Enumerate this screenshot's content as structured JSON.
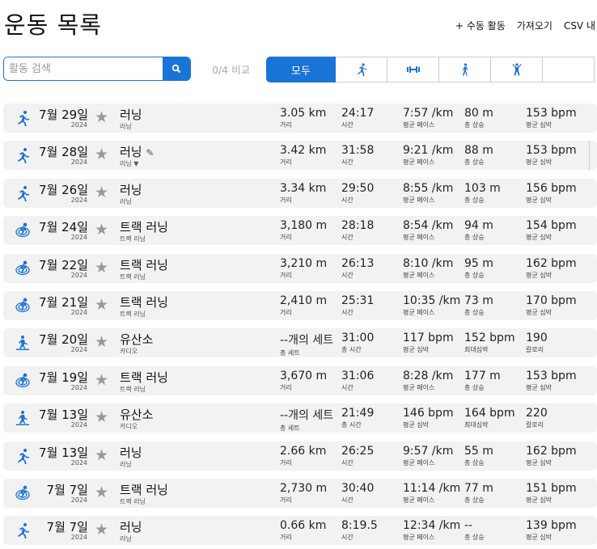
{
  "header": {
    "title": "운동 목록",
    "add_manual": "+ 수동 활동",
    "import": "가져오기",
    "csv": "CSV 내"
  },
  "search": {
    "placeholder": "활동 검색",
    "compare": "0/4 비교"
  },
  "tabs": [
    {
      "label": "모두"
    },
    {
      "icon": "running-icon"
    },
    {
      "icon": "strength-icon"
    },
    {
      "icon": "walking-icon"
    },
    {
      "icon": "cardio-icon"
    },
    {
      "icon": "more"
    }
  ],
  "activities": [
    {
      "type": "run",
      "date": "7월 29일",
      "year": "2024",
      "name": "러닝",
      "sub": "러닝",
      "stats": [
        [
          "3.05 km",
          "거리"
        ],
        [
          "24:17",
          "시간"
        ],
        [
          "7:57 /km",
          "평균 페이스"
        ],
        [
          "80 m",
          "총 상승"
        ],
        [
          "153 bpm",
          "평균 심박"
        ]
      ]
    },
    {
      "type": "run",
      "date": "7월 28일",
      "year": "2024",
      "name": "러닝",
      "sub": "러닝 ▼",
      "edit": true,
      "stats": [
        [
          "3.42 km",
          "거리"
        ],
        [
          "31:58",
          "시간"
        ],
        [
          "9:21 /km",
          "평균 페이스"
        ],
        [
          "88 m",
          "총 상승"
        ],
        [
          "153 bpm",
          "평균 심박"
        ]
      ]
    },
    {
      "type": "run",
      "date": "7월 26일",
      "year": "2024",
      "name": "러닝",
      "sub": "러닝",
      "stats": [
        [
          "3.34 km",
          "거리"
        ],
        [
          "29:50",
          "시간"
        ],
        [
          "8:55 /km",
          "평균 페이스"
        ],
        [
          "103 m",
          "총 상승"
        ],
        [
          "156 bpm",
          "평균 심박"
        ]
      ]
    },
    {
      "type": "track",
      "date": "7월 24일",
      "year": "2024",
      "name": "트랙 러닝",
      "sub": "트랙 러닝",
      "stats": [
        [
          "3,180 m",
          "거리"
        ],
        [
          "28:18",
          "시간"
        ],
        [
          "8:54 /km",
          "평균 페이스"
        ],
        [
          "94 m",
          "총 상승"
        ],
        [
          "154 bpm",
          "평균 심박"
        ]
      ]
    },
    {
      "type": "track",
      "date": "7월 22일",
      "year": "2024",
      "name": "트랙 러닝",
      "sub": "트랙 러닝",
      "stats": [
        [
          "3,210 m",
          "거리"
        ],
        [
          "26:13",
          "시간"
        ],
        [
          "8:10 /km",
          "평균 페이스"
        ],
        [
          "95 m",
          "총 상승"
        ],
        [
          "162 bpm",
          "평균 심박"
        ]
      ]
    },
    {
      "type": "track",
      "date": "7월 21일",
      "year": "2024",
      "name": "트랙 러닝",
      "sub": "트랙 러닝",
      "stats": [
        [
          "2,410 m",
          "거리"
        ],
        [
          "25:31",
          "시간"
        ],
        [
          "10:35 /km",
          "평균 페이스"
        ],
        [
          "73 m",
          "총 상승"
        ],
        [
          "170 bpm",
          "평균 심박"
        ]
      ]
    },
    {
      "type": "cardio",
      "date": "7월 20일",
      "year": "2024",
      "name": "유산소",
      "sub": "카디오",
      "stats": [
        [
          "--개의 세트",
          "총 세트"
        ],
        [
          "31:00",
          "총 시간"
        ],
        [
          "117 bpm",
          "평균 심박"
        ],
        [
          "152 bpm",
          "최대심박"
        ],
        [
          "190",
          "칼로리"
        ]
      ]
    },
    {
      "type": "track",
      "date": "7월 19일",
      "year": "2024",
      "name": "트랙 러닝",
      "sub": "트랙 러닝",
      "stats": [
        [
          "3,670 m",
          "거리"
        ],
        [
          "31:06",
          "시간"
        ],
        [
          "8:28 /km",
          "평균 페이스"
        ],
        [
          "177 m",
          "총 상승"
        ],
        [
          "153 bpm",
          "평균 심박"
        ]
      ]
    },
    {
      "type": "cardio",
      "date": "7월 13일",
      "year": "2024",
      "name": "유산소",
      "sub": "카디오",
      "stats": [
        [
          "--개의 세트",
          "총 세트"
        ],
        [
          "21:49",
          "총 시간"
        ],
        [
          "146 bpm",
          "평균 심박"
        ],
        [
          "164 bpm",
          "최대심박"
        ],
        [
          "220",
          "칼로리"
        ]
      ]
    },
    {
      "type": "run",
      "date": "7월 13일",
      "year": "2024",
      "name": "러닝",
      "sub": "러닝",
      "stats": [
        [
          "2.66 km",
          "거리"
        ],
        [
          "26:25",
          "시간"
        ],
        [
          "9:57 /km",
          "평균 페이스"
        ],
        [
          "55 m",
          "총 상승"
        ],
        [
          "162 bpm",
          "평균 심박"
        ]
      ]
    },
    {
      "type": "track",
      "date": "7월 7일",
      "year": "2024",
      "name": "트랙 러닝",
      "sub": "트랙 러닝",
      "stats": [
        [
          "2,730 m",
          "거리"
        ],
        [
          "30:40",
          "시간"
        ],
        [
          "11:14 /km",
          "평균 페이스"
        ],
        [
          "77 m",
          "총 상승"
        ],
        [
          "151 bpm",
          "평균 심박"
        ]
      ]
    },
    {
      "type": "run",
      "date": "7월 7일",
      "year": "2024",
      "name": "러닝",
      "sub": "러닝",
      "stats": [
        [
          "0.66 km",
          "거리"
        ],
        [
          "8:19.5",
          "시간"
        ],
        [
          "12:34 /km",
          "평균 페이스"
        ],
        [
          "--",
          "총 상승"
        ],
        [
          "139 bpm",
          "평균 심박"
        ]
      ]
    }
  ],
  "colors": {
    "accent": "#1a73d6",
    "row_bg": "#f2f2f2"
  }
}
